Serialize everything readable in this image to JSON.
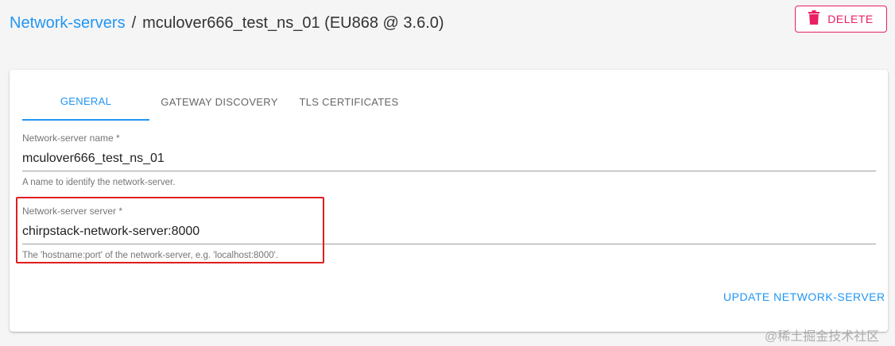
{
  "breadcrumb": {
    "link": "Network-servers",
    "separator": "/",
    "current": "mculover666_test_ns_01 (EU868 @ 3.6.0)"
  },
  "delete_button": {
    "label": "DELETE",
    "icon": "trash-icon",
    "color": "#e91e63"
  },
  "tabs": [
    {
      "label": "GENERAL",
      "active": true
    },
    {
      "label": "GATEWAY DISCOVERY",
      "active": false
    },
    {
      "label": "TLS CERTIFICATES",
      "active": false
    }
  ],
  "form": {
    "name_field": {
      "label": "Network-server name *",
      "value": "mculover666_test_ns_01",
      "help": "A name to identify the network-server."
    },
    "server_field": {
      "label": "Network-server server *",
      "value": "chirpstack-network-server:8000",
      "help": "The 'hostname:port' of the network-server, e.g. 'localhost:8000'."
    }
  },
  "update_button": {
    "label": "UPDATE NETWORK-SERVER"
  },
  "watermark": "@稀土掘金技术社区",
  "colors": {
    "accent": "#2196f3",
    "danger": "#e91e63",
    "highlight": "#e01e1e"
  }
}
